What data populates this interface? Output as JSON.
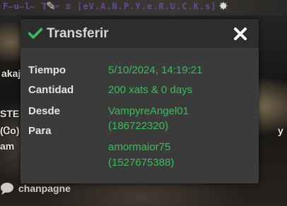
{
  "background": {
    "top_banner": "F̶u̶l̶ 𝕋 ═ ≡ [eV.A.N.P.Y.e.R.U.C.K.s]",
    "side_left": [
      "akaja",
      "STE",
      "(Ꮳo)",
      "am"
    ],
    "side_right": [
      "y"
    ],
    "footer_name": "chanpagne"
  },
  "modal": {
    "title": "Transferir",
    "rows": [
      {
        "label": "Tiempo",
        "value": "5/10/2024, 14:19:21"
      },
      {
        "label": "Cantidad",
        "value": "200 xats & 0 days"
      },
      {
        "label": "Desde",
        "value": "VampyreAngel01",
        "value2": "(186722320)"
      },
      {
        "label": "Para",
        "value": "amormaior75",
        "value2": "(1527675388)"
      }
    ]
  },
  "colors": {
    "accent_green": "#3cbb5b",
    "modal_bg": "#3b3b3b",
    "header_bg": "#2d2d2d"
  }
}
